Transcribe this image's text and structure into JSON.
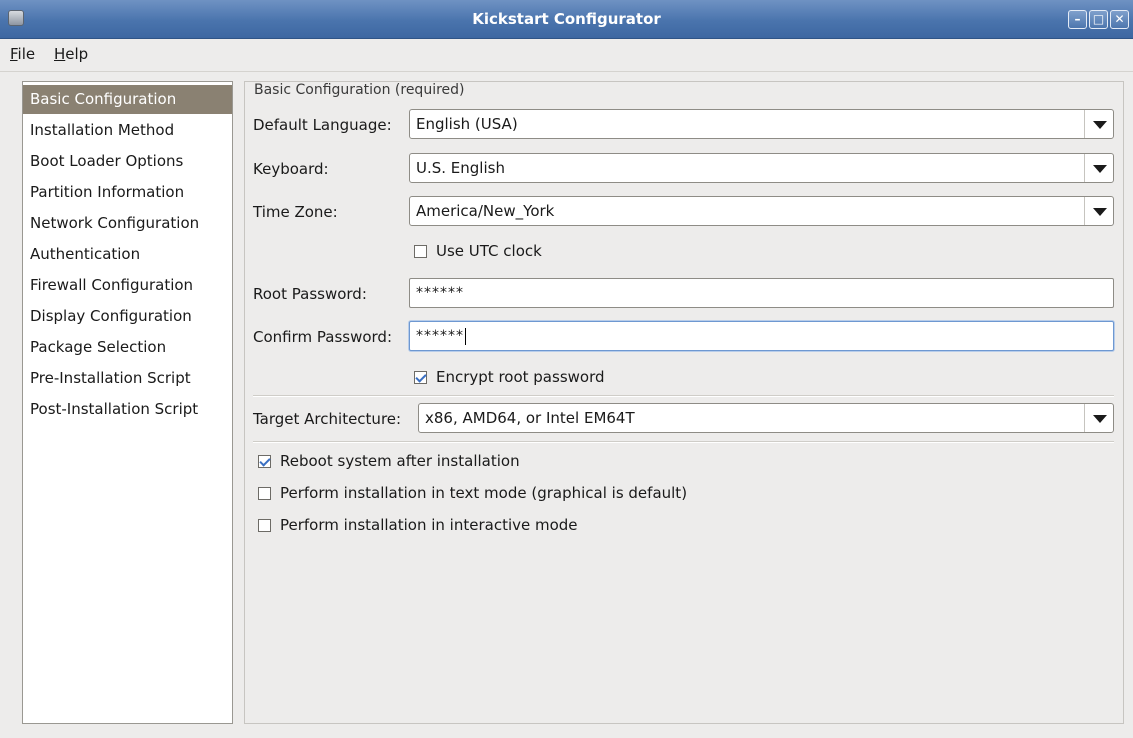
{
  "window": {
    "title": "Kickstart Configurator"
  },
  "menu": {
    "file": "ile",
    "file_mnemonic": "F",
    "help": "elp",
    "help_mnemonic": "H"
  },
  "sidebar": {
    "items": [
      {
        "label": "Basic Configuration",
        "selected": true
      },
      {
        "label": "Installation Method"
      },
      {
        "label": "Boot Loader Options"
      },
      {
        "label": "Partition Information"
      },
      {
        "label": "Network Configuration"
      },
      {
        "label": "Authentication"
      },
      {
        "label": "Firewall Configuration"
      },
      {
        "label": "Display Configuration"
      },
      {
        "label": "Package Selection"
      },
      {
        "label": "Pre-Installation Script"
      },
      {
        "label": "Post-Installation Script"
      }
    ]
  },
  "basic": {
    "group_title": "Basic Configuration (required)",
    "default_language": {
      "label": "Default Language:",
      "value": "English (USA)"
    },
    "keyboard": {
      "label": "Keyboard:",
      "value": "U.S. English"
    },
    "time_zone": {
      "label": "Time Zone:",
      "value": "America/New_York"
    },
    "utc_clock": {
      "label": "Use UTC clock",
      "checked": false
    },
    "root_password": {
      "label": "Root Password:",
      "value": "******"
    },
    "confirm_password": {
      "label": "Confirm Password:",
      "value": "******"
    },
    "encrypt_root": {
      "label": "Encrypt root password",
      "checked": true
    },
    "target_arch": {
      "label": "Target Architecture:",
      "value": "x86, AMD64, or Intel EM64T"
    },
    "reboot": {
      "label": "Reboot system after installation",
      "checked": true
    },
    "text_mode": {
      "label": "Perform installation in text mode (graphical is default)",
      "checked": false
    },
    "interactive": {
      "label": "Perform installation in interactive mode",
      "checked": false
    }
  },
  "colors": {
    "titlebar": "#4a74ad",
    "selection": "#8a8172",
    "window_bg": "#edeceb",
    "check": "#3a6fc2"
  }
}
